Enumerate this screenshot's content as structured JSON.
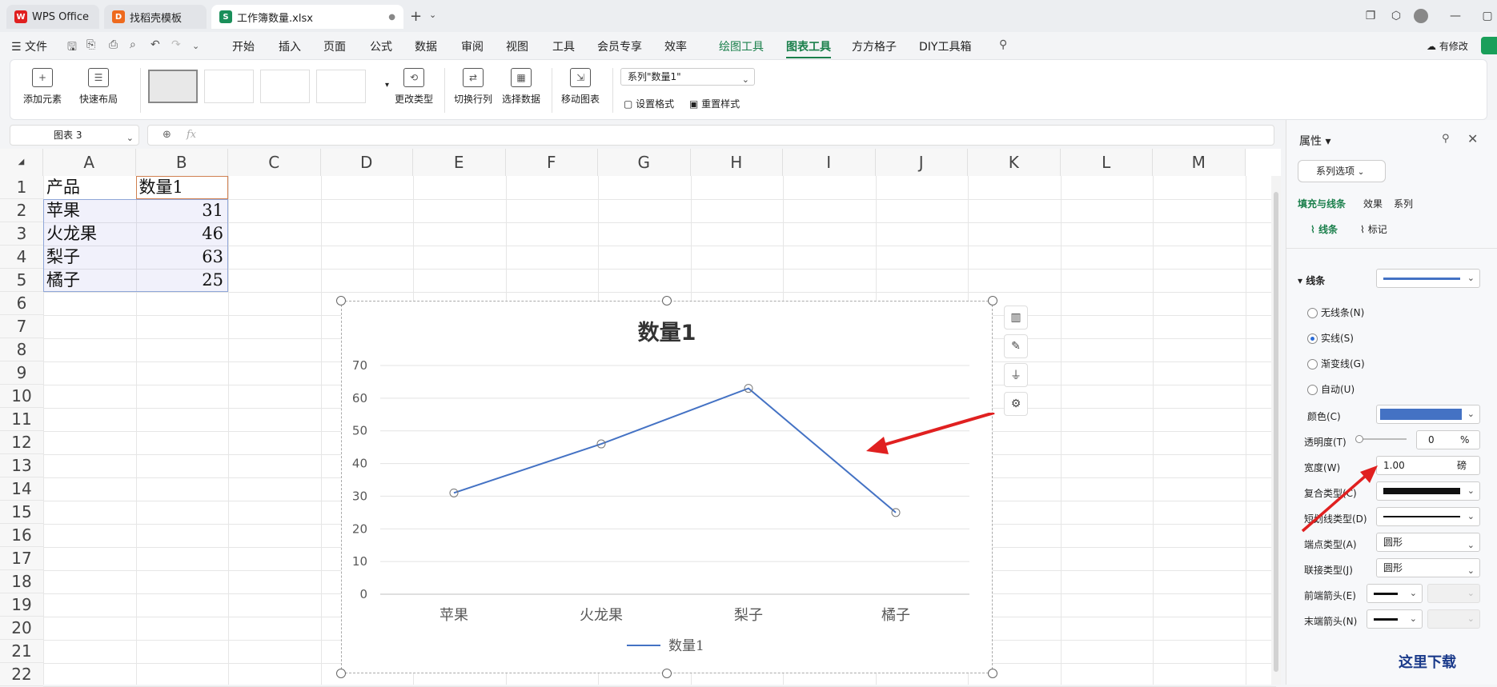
{
  "tabs": [
    {
      "label": "WPS Office"
    },
    {
      "label": "找稻壳模板"
    },
    {
      "label": "工作簿数量.xlsx"
    }
  ],
  "menu": {
    "file": "文件",
    "items": [
      "开始",
      "插入",
      "页面",
      "公式",
      "数据",
      "审阅",
      "视图",
      "工具",
      "会员专享",
      "效率"
    ],
    "tool_items": [
      "绘图工具",
      "图表工具",
      "方方格子",
      "DIY工具箱"
    ],
    "modify": "有修改"
  },
  "ribbon": {
    "add_element": "添加元素",
    "quick_layout": "快速布局",
    "change_type": "更改类型",
    "switch_rowcol": "切换行列",
    "select_data": "选择数据",
    "move_chart": "移动图表",
    "series_select": "系列\"数量1\"",
    "set_format": "设置格式",
    "reset_style": "重置样式"
  },
  "namebox": "图表 3",
  "fx": "fx",
  "columns": [
    "A",
    "B",
    "C",
    "D",
    "E",
    "F",
    "G",
    "H",
    "I",
    "J",
    "K",
    "L",
    "M"
  ],
  "rows": [
    "1",
    "2",
    "3",
    "4",
    "5",
    "6",
    "7",
    "8",
    "9",
    "10",
    "11",
    "12",
    "13",
    "14",
    "15",
    "16",
    "17",
    "18",
    "19",
    "20",
    "21",
    "22"
  ],
  "table": {
    "header": [
      "产品",
      "数量1"
    ],
    "rows": [
      [
        "苹果",
        "31"
      ],
      [
        "火龙果",
        "46"
      ],
      [
        "梨子",
        "63"
      ],
      [
        "橘子",
        "25"
      ]
    ]
  },
  "chart_data": {
    "type": "line",
    "title": "数量1",
    "categories": [
      "苹果",
      "火龙果",
      "梨子",
      "橘子"
    ],
    "series": [
      {
        "name": "数量1",
        "values": [
          31,
          46,
          63,
          25
        ],
        "color": "#4472c4"
      }
    ],
    "ylim": [
      0,
      70
    ],
    "yticks": [
      "0",
      "10",
      "20",
      "30",
      "40",
      "50",
      "60",
      "70"
    ],
    "grid": true,
    "legend": "bottom"
  },
  "panel": {
    "title": "属性",
    "series_options": "系列选项",
    "tabs": [
      "填充与线条",
      "效果",
      "系列"
    ],
    "subtabs": [
      "线条",
      "标记"
    ],
    "section": "线条",
    "radios": [
      "无线条(N)",
      "实线(S)",
      "渐变线(G)",
      "自动(U)"
    ],
    "color_label": "颜色(C)",
    "line_color": "#4472c4",
    "transparency_label": "透明度(T)",
    "transparency_value": "0",
    "transparency_unit": "%",
    "width_label": "宽度(W)",
    "width_value": "1.00",
    "width_unit": "磅",
    "compound_label": "复合类型(C)",
    "dash_label": "短划线类型(D)",
    "cap_label": "端点类型(A)",
    "cap_value": "圆形",
    "join_label": "联接类型(J)",
    "join_value": "圆形",
    "begin_arrow_label": "前端箭头(E)",
    "end_arrow_label": "末端箭头(N)"
  },
  "watermark": "这里下载"
}
